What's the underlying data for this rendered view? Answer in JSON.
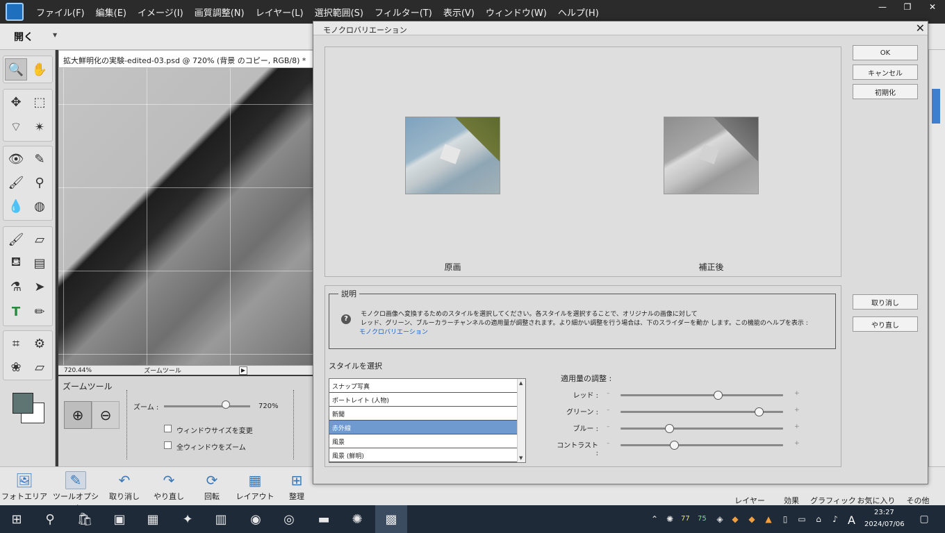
{
  "menubar": {
    "items": [
      "ファイル(F)",
      "編集(E)",
      "イメージ(I)",
      "画質調整(N)",
      "レイヤー(L)",
      "選択範囲(S)",
      "フィルター(T)",
      "表示(V)",
      "ウィンドウ(W)",
      "ヘルプ(H)"
    ],
    "window_buttons": [
      "—",
      "❐",
      "✕"
    ]
  },
  "optbar": {
    "open_label": "開く"
  },
  "document": {
    "tab_title": "拡大鮮明化の実験-edited-03.psd @ 720% (背景 のコピー, RGB/8) *",
    "tab_close": "×",
    "status_zoom": "720.44%",
    "status_tool": "ズームツール"
  },
  "tool_options": {
    "title": "ズームツール",
    "zoom_label": "ズーム :",
    "zoom_value": "720%",
    "zoom_fraction": 0.72,
    "resize_window": "ウィンドウサイズを変更",
    "zoom_all": "全ウィンドウをズーム"
  },
  "dock": {
    "items": [
      {
        "label": "フォトエリア",
        "icon": "photo-bin-icon"
      },
      {
        "label": "ツールオプション",
        "icon": "tool-options-icon"
      },
      {
        "label": "取り消し",
        "icon": "undo-icon"
      },
      {
        "label": "やり直し",
        "icon": "redo-icon"
      },
      {
        "label": "回転",
        "icon": "rotate-icon"
      },
      {
        "label": "レイアウト",
        "icon": "layout-icon"
      },
      {
        "label": "整理",
        "icon": "organizer-icon"
      }
    ],
    "right_items": [
      "レイヤー",
      "効果",
      "グラフィック",
      "お気に入り",
      "その他"
    ]
  },
  "dialog": {
    "title": "モノクロバリエーション",
    "close": "✕",
    "before_label": "原画",
    "after_label": "補正後",
    "buttons": {
      "ok": "OK",
      "cancel": "キャンセル",
      "reset": "初期化",
      "undo": "取り消し",
      "redo": "やり直し"
    },
    "description": {
      "legend": "説明",
      "line1": "モノクロ画像へ変換するためのスタイルを選択してください。各スタイルを選択することで、オリジナルの画像に対して",
      "line2": "レッド、グリーン、ブルーカラーチャンネルの適用量が調整されます。より細かい調整を行う場合は、下のスライダーを動か します。この機能のヘルプを表示 :",
      "link": "モノクロバリエーション"
    },
    "style_label": "スタイルを選択",
    "styles": [
      "スナップ写真",
      "ポートレイト (人物)",
      "新聞",
      "赤外線",
      "風景",
      "風景 (鮮明)"
    ],
    "selected_style_index": 3,
    "adjust_label": "適用量の調整 :",
    "sliders": [
      {
        "label": "レッド :",
        "value": 0.6
      },
      {
        "label": "グリーン :",
        "value": 0.85
      },
      {
        "label": "ブルー :",
        "value": 0.3
      },
      {
        "label": "コントラスト :",
        "value": 0.33
      }
    ],
    "minus": "–",
    "plus": "+"
  },
  "taskbar": {
    "tray_numbers": [
      "77",
      "75"
    ],
    "ime": "A",
    "time": "23:27",
    "date": "2024/07/06"
  }
}
